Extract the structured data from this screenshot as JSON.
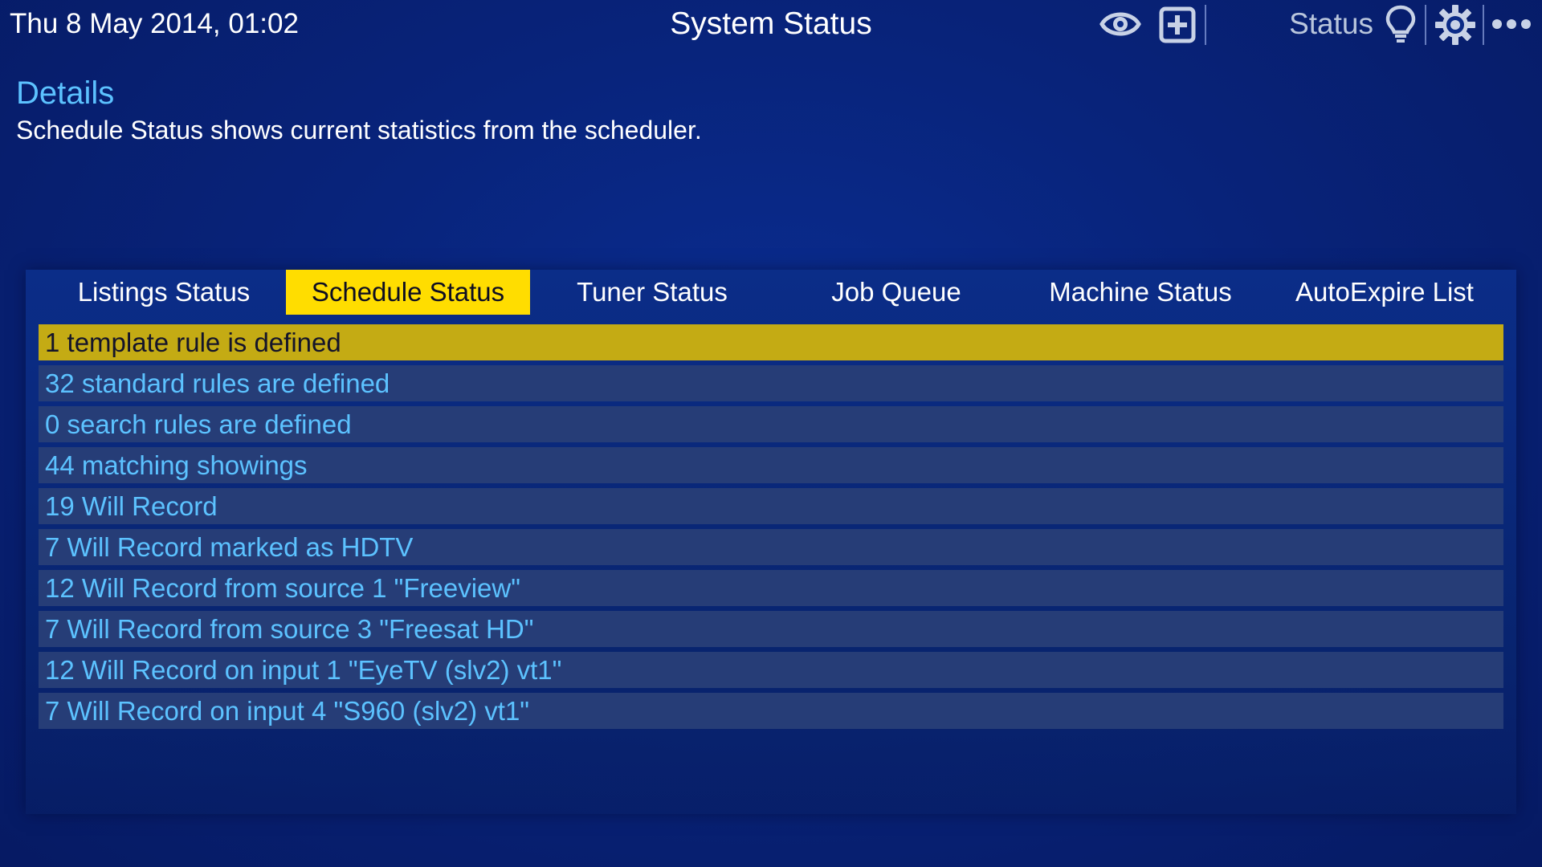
{
  "header": {
    "datetime": "Thu 8 May 2014, 01:02",
    "title": "System Status",
    "status_label": "Status",
    "icons": [
      "eye-icon",
      "add-icon",
      "lightbulb-icon",
      "gear-icon",
      "more-icon"
    ]
  },
  "details": {
    "heading": "Details",
    "description": "Schedule Status shows current statistics from the scheduler."
  },
  "tabs": [
    {
      "label": "Listings Status",
      "active": false
    },
    {
      "label": "Schedule Status",
      "active": true
    },
    {
      "label": "Tuner Status",
      "active": false
    },
    {
      "label": "Job Queue",
      "active": false
    },
    {
      "label": "Machine Status",
      "active": false
    },
    {
      "label": "AutoExpire List",
      "active": false
    }
  ],
  "rows": [
    {
      "text": "1 template rule is defined",
      "selected": true
    },
    {
      "text": "32 standard rules are defined",
      "selected": false
    },
    {
      "text": "0 search rules are defined",
      "selected": false
    },
    {
      "text": "44 matching showings",
      "selected": false
    },
    {
      "text": "19 Will Record",
      "selected": false
    },
    {
      "text": "7 Will Record marked as HDTV",
      "selected": false
    },
    {
      "text": "12 Will Record from source 1 \"Freeview\"",
      "selected": false
    },
    {
      "text": "7 Will Record from source 3 \"Freesat HD\"",
      "selected": false
    },
    {
      "text": "12 Will Record on input 1 \"EyeTV (slv2) vt1\"",
      "selected": false
    },
    {
      "text": "7 Will Record on input 4 \"S960 (slv2) vt1\"",
      "selected": false
    }
  ],
  "colors": {
    "background": "#08237a",
    "accent_text": "#5cc2ff",
    "active_tab": "#ffdd00",
    "selected_row": "#c4ab14",
    "row": "#263d77"
  }
}
